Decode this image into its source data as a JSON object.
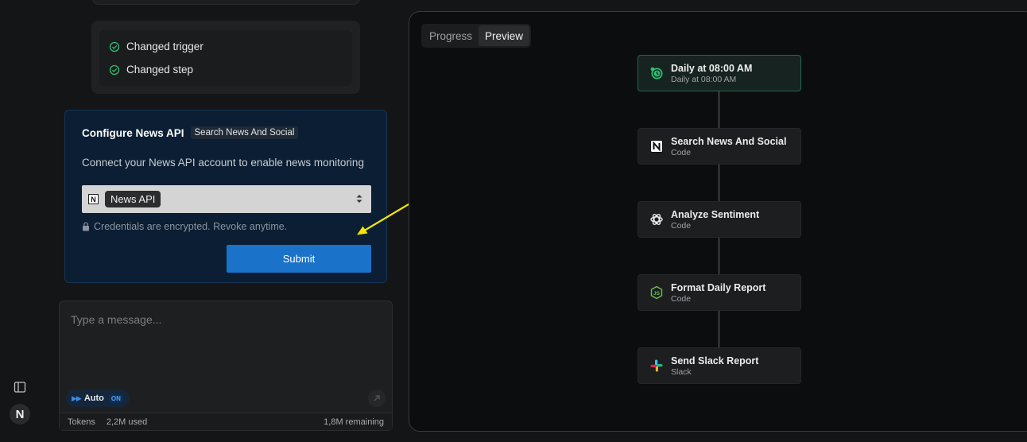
{
  "rail": {
    "avatar_letter": "N"
  },
  "changes": [
    {
      "label": "Changed trigger"
    },
    {
      "label": "Changed step"
    }
  ],
  "config": {
    "title": "Configure News API",
    "tag": "Search News And Social",
    "description": "Connect your News API account to enable news monitoring",
    "select_value": "News API",
    "select_icon_letter": "N",
    "note": "Credentials are encrypted. Revoke anytime.",
    "submit_label": "Submit"
  },
  "composer": {
    "placeholder": "Type a message...",
    "auto_label": "Auto",
    "auto_state": "ON",
    "tokens_label": "Tokens",
    "tokens_used": "2,2M used",
    "tokens_remaining": "1,8M remaining"
  },
  "panel": {
    "tabs": [
      {
        "label": "Progress",
        "active": false
      },
      {
        "label": "Preview",
        "active": true
      }
    ],
    "nodes": [
      {
        "title": "Daily at 08:00 AM",
        "subtitle": "Daily at 08:00 AM",
        "icon": "clock-icon"
      },
      {
        "title": "Search News And Social",
        "subtitle": "Code",
        "icon": "notion-icon"
      },
      {
        "title": "Analyze Sentiment",
        "subtitle": "Code",
        "icon": "openai-icon"
      },
      {
        "title": "Format Daily Report",
        "subtitle": "Code",
        "icon": "nodejs-icon"
      },
      {
        "title": "Send Slack Report",
        "subtitle": "Slack",
        "icon": "slack-icon"
      }
    ]
  },
  "colors": {
    "accent_blue": "#1a73c9",
    "success_green": "#2fbf71",
    "annotation_yellow": "#f2e600"
  }
}
